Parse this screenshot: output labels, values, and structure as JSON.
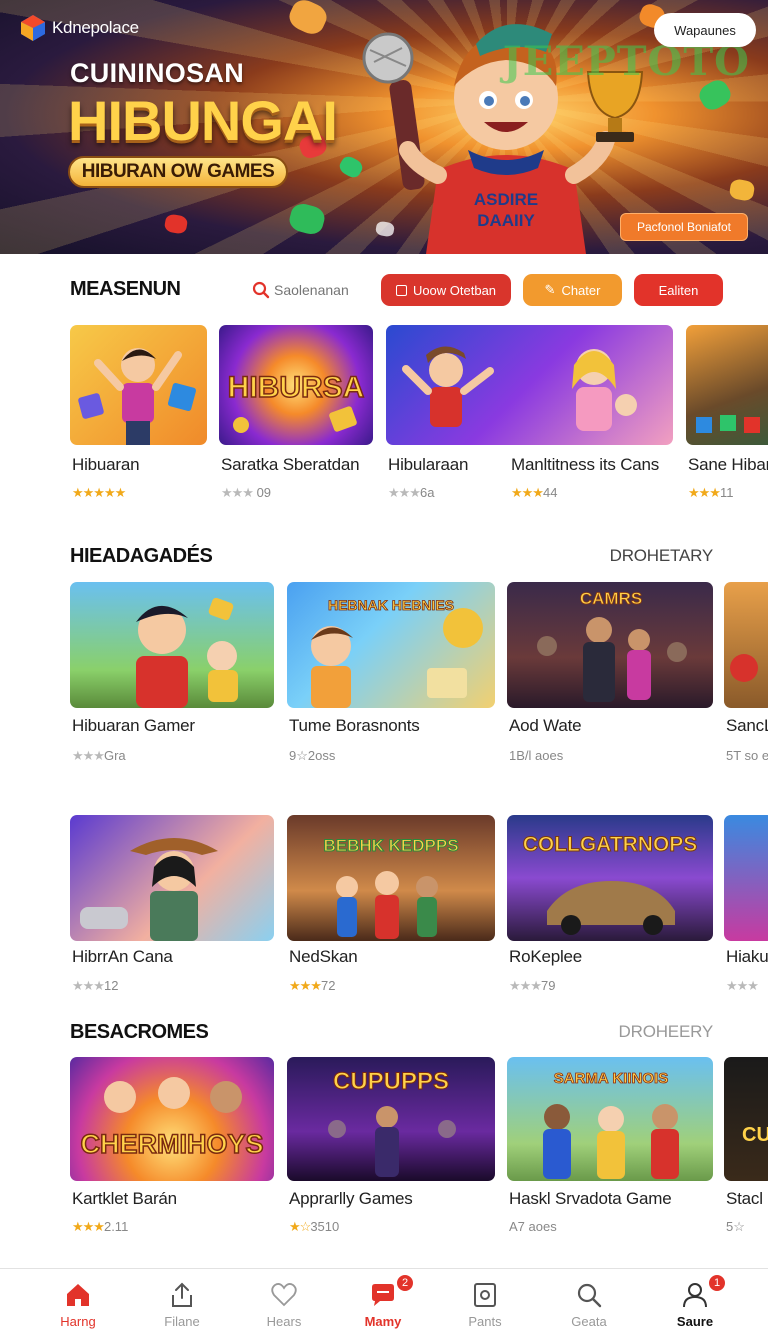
{
  "app": {
    "brand": "Kdnepolace"
  },
  "hero": {
    "top_button": "Wapaunes",
    "watermark": "JEEPTOTO",
    "subtitle": "CUININOSAN",
    "title": "HIBUNGAI",
    "pill": "HIBURAN OW GAMES",
    "promo_button": "Pacfonol Boniafot",
    "shirt_text_1": "ASDIRE",
    "shirt_text_2": "DAAIIY"
  },
  "toolbar": {
    "title": "MEASENUN",
    "search_placeholder": "Saolenanan",
    "chip1": "Uoow Otetban",
    "chip2": "Chater",
    "chip3": "Ealiten",
    "colors": {
      "chip1": "#d9352c",
      "chip2": "#f29a2e",
      "chip3": "#e2332a"
    }
  },
  "rows": {
    "row1": [
      {
        "title": "Hibuaran",
        "rating": "★★★★★",
        "meta": "",
        "stars_color": "gold"
      },
      {
        "title": "Saratka Sberatdan",
        "rating": "★★★",
        "meta": " 09",
        "stars_color": "gray",
        "art": "HIBURSA"
      },
      {
        "title": "Hibularaan",
        "rating": "★★★",
        "meta": "6a",
        "stars_color": "gray"
      },
      {
        "title": "Manltitness its Cans",
        "rating": "★★★",
        "meta": "44",
        "stars_color": "gold"
      },
      {
        "title": "Sane Hibar",
        "rating": "★★★",
        "meta": "11",
        "stars_color": "gold"
      }
    ]
  },
  "section2": {
    "title": "HIEADAGADÉS",
    "link": "DROHETARY",
    "row_a": [
      {
        "title": "Hibuaran Gamer",
        "rating": "★★★",
        "meta": "Gra",
        "stars_color": "gray"
      },
      {
        "title": "Tume Borasnonts",
        "rating": "",
        "meta": "9☆2oss",
        "stars_color": "gray",
        "art": "HEBNAK HEBNIES"
      },
      {
        "title": "Aod Wate",
        "rating": "",
        "meta": "1B/l aoes",
        "stars_color": "gray",
        "art": "CAMRS"
      },
      {
        "title": "SancL",
        "rating": "",
        "meta": "5T so e",
        "stars_color": "gray"
      }
    ],
    "row_b": [
      {
        "title": "HibrrAn Cana",
        "rating": "★★★",
        "meta": "12",
        "stars_color": "gray"
      },
      {
        "title": "NedSkan",
        "rating": "★★★",
        "meta": "72",
        "stars_color": "gold",
        "art": "BEBHK KEDPPS"
      },
      {
        "title": "RoKeplee",
        "rating": "★★★",
        "meta": "79",
        "stars_color": "gray",
        "art": "COLLGATRNOPS"
      },
      {
        "title": "Hiaku",
        "rating": "★★★",
        "meta": "",
        "stars_color": "gray"
      }
    ]
  },
  "section3": {
    "title": "BESACROMES",
    "link": "DROHEERY",
    "row": [
      {
        "title": "Kartklet Barán",
        "rating": "★★★",
        "meta": "2.11",
        "stars_color": "gold",
        "art": "CHERMIHOYS"
      },
      {
        "title": "Apprarlly Games",
        "rating": "★☆",
        "meta": "3510",
        "stars_color": "gold",
        "art": "CUPUPPS"
      },
      {
        "title": "Haskl Srvadota Game",
        "rating": "",
        "meta": "A7 aoes",
        "stars_color": "gray",
        "art": "SARMA KIINOIS"
      },
      {
        "title": "Stacl",
        "rating": "",
        "meta": "5☆",
        "stars_color": "gray",
        "art": "CU"
      }
    ]
  },
  "nav": [
    {
      "label": "Harng",
      "icon": "home-icon",
      "state": "active"
    },
    {
      "label": "Filane",
      "icon": "share-icon",
      "state": ""
    },
    {
      "label": "Hears",
      "icon": "heart-icon",
      "state": ""
    },
    {
      "label": "Mamy",
      "icon": "chat-icon",
      "state": "active",
      "badge": "2"
    },
    {
      "label": "Pants",
      "icon": "frame-icon",
      "state": ""
    },
    {
      "label": "Geata",
      "icon": "search-icon",
      "state": ""
    },
    {
      "label": "Saure",
      "icon": "profile-icon",
      "state": "bold",
      "badge": "1"
    }
  ]
}
